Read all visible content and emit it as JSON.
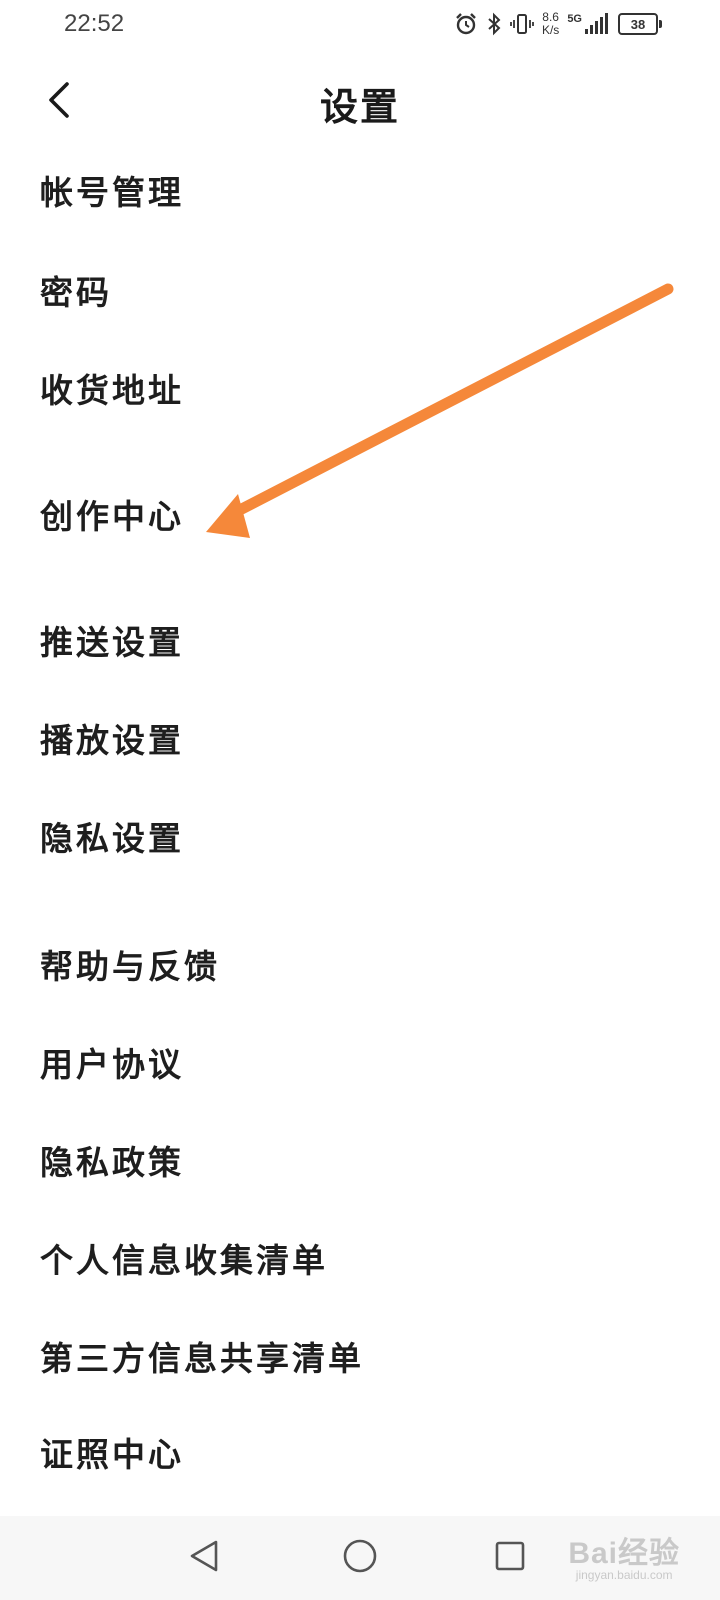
{
  "status_bar": {
    "time": "22:52",
    "net_speed_value": "8.6",
    "net_speed_unit": "K/s",
    "network": "5G",
    "battery": "38",
    "icons": [
      "alarm-icon",
      "bluetooth-icon",
      "vibrate-icon",
      "signal-icon",
      "battery-icon"
    ]
  },
  "header": {
    "title": "设置",
    "back_icon": "chevron-left-icon"
  },
  "menu": {
    "items": [
      {
        "label": "帐号管理"
      },
      {
        "label": "密码"
      },
      {
        "label": "收货地址"
      },
      {
        "label": "创作中心"
      },
      {
        "label": "推送设置"
      },
      {
        "label": "播放设置"
      },
      {
        "label": "隐私设置"
      },
      {
        "label": "帮助与反馈"
      },
      {
        "label": "用户协议"
      },
      {
        "label": "隐私政策"
      },
      {
        "label": "个人信息收集清单"
      },
      {
        "label": "第三方信息共享清单"
      },
      {
        "label": "证照中心"
      }
    ]
  },
  "annotation": {
    "arrow_color": "#F5883A",
    "points_to": "创作中心"
  },
  "nav_bar": {
    "icons": [
      "back-triangle-icon",
      "home-circle-icon",
      "recents-square-icon"
    ]
  },
  "watermark": {
    "text": "Bai经验",
    "sub": "jingyan.baidu.com"
  }
}
